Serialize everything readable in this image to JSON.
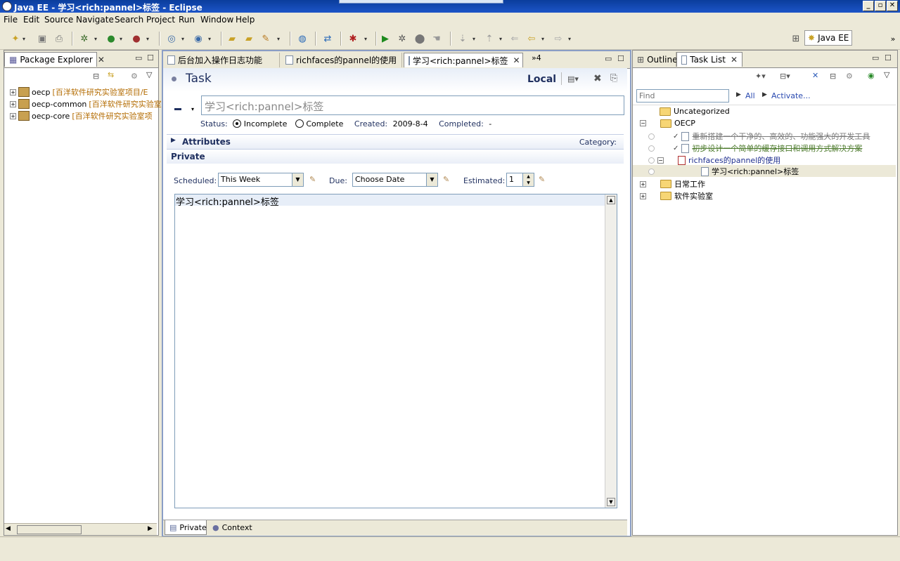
{
  "window": {
    "title": "Java EE - 学习<rich:pannel>标签 - Eclipse"
  },
  "menu": [
    "File",
    "Edit",
    "Source",
    "Navigate",
    "Search",
    "Project",
    "Run",
    "Window",
    "Help"
  ],
  "perspective": {
    "label": "Java EE"
  },
  "package_explorer": {
    "tab_label": "Package Explorer",
    "projects": [
      {
        "name": "oecp",
        "desc": "[百洋软件研究实验室项目/E"
      },
      {
        "name": "oecp-common",
        "desc": "[百洋软件研究实验室"
      },
      {
        "name": "oecp-core",
        "desc": "[百洋软件研究实验室项"
      }
    ]
  },
  "editor": {
    "tabs": [
      "后台加入操作日志功能",
      "richfaces的pannel的使用",
      "学习<rich:pannel>标签"
    ],
    "overflow": "»4",
    "heading": "Task",
    "repository": "Local",
    "summary": "学习<rich:pannel>标签",
    "status_label": "Status:",
    "incomplete": "Incomplete",
    "complete": "Complete",
    "created_label": "Created:",
    "created_value": "2009-8-4",
    "completed_label": "Completed:",
    "completed_value": "-",
    "attributes": "Attributes",
    "category": "Category:",
    "private": "Private",
    "scheduled_label": "Scheduled:",
    "scheduled_value": "This Week",
    "due_label": "Due:",
    "due_value": "Choose Date",
    "estimated_label": "Estimated:",
    "estimated_value": "1",
    "notes": "学习<rich:pannel>标签",
    "bottom_tabs": [
      "Private",
      "Context"
    ]
  },
  "task_list": {
    "tabs": [
      "Outline",
      "Task List"
    ],
    "find_placeholder": "Find",
    "all_label": "All",
    "activate_label": "Activate...",
    "items": [
      {
        "label": "Uncategorized",
        "kind": "folder"
      },
      {
        "label": "OECP",
        "kind": "folder"
      },
      {
        "label": "重新搭建一个干净的、高效的、功能强大的开发工具",
        "kind": "done"
      },
      {
        "label": "初步设计一个简单的缓存接口和调用方式解决方案",
        "kind": "done"
      },
      {
        "label": "richfaces的pannel的使用",
        "kind": "task"
      },
      {
        "label": "学习<rich:pannel>标签",
        "kind": "task"
      },
      {
        "label": "日常工作",
        "kind": "folder"
      },
      {
        "label": "软件实验室",
        "kind": "folder"
      }
    ]
  }
}
